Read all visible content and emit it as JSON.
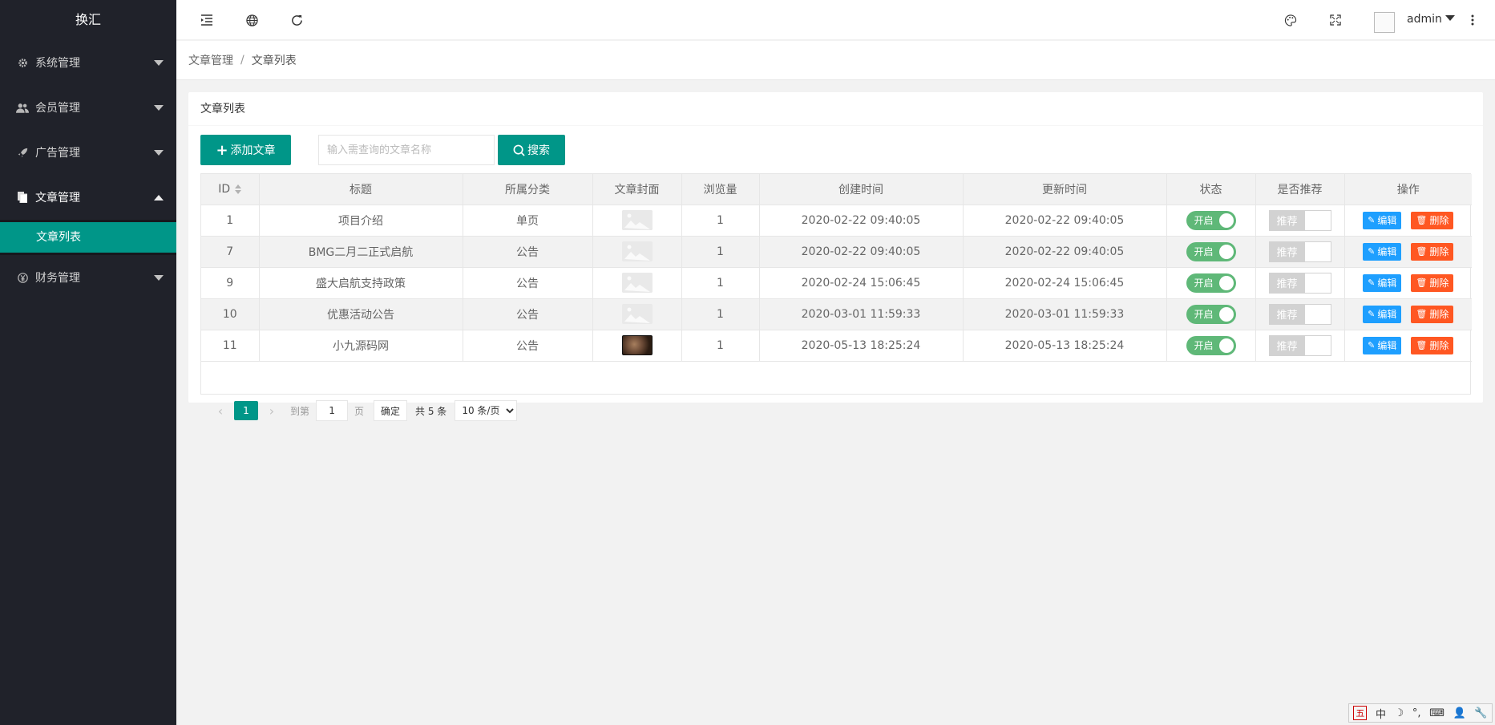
{
  "app": {
    "logo": "换汇"
  },
  "sidebar": {
    "items": [
      {
        "label": "系统管理",
        "icon": "gear-icon"
      },
      {
        "label": "会员管理",
        "icon": "users-icon"
      },
      {
        "label": "广告管理",
        "icon": "rocket-icon"
      },
      {
        "label": "文章管理",
        "icon": "file-icon",
        "open": true,
        "children": [
          {
            "label": "文章列表",
            "active": true
          }
        ]
      },
      {
        "label": "财务管理",
        "icon": "yen-icon"
      }
    ]
  },
  "header": {
    "user": "admin",
    "icons": [
      "menu-fold-icon",
      "globe-icon",
      "refresh-icon",
      "palette-icon",
      "fullscreen-icon",
      "more-icon"
    ]
  },
  "breadcrumb": {
    "items": [
      "文章管理",
      "文章列表"
    ],
    "separator": "/"
  },
  "card": {
    "title": "文章列表",
    "add_label": "添加文章",
    "search_placeholder": "输入需查询的文章名称",
    "search_label": "搜索"
  },
  "table": {
    "columns": [
      "ID",
      "标题",
      "所属分类",
      "文章封面",
      "浏览量",
      "创建时间",
      "更新时间",
      "状态",
      "是否推荐",
      "操作"
    ],
    "rows": [
      {
        "id": "1",
        "title": "项目介绍",
        "category": "单页",
        "cover": "placeholder",
        "views": "1",
        "created": "2020-02-22 09:40:05",
        "updated": "2020-02-22 09:40:05",
        "status": "开启",
        "recommend": "推荐"
      },
      {
        "id": "7",
        "title": "BMG二月二正式启航",
        "category": "公告",
        "cover": "placeholder",
        "views": "1",
        "created": "2020-02-22 09:40:05",
        "updated": "2020-02-22 09:40:05",
        "status": "开启",
        "recommend": "推荐"
      },
      {
        "id": "9",
        "title": "盛大启航支持政策",
        "category": "公告",
        "cover": "placeholder",
        "views": "1",
        "created": "2020-02-24 15:06:45",
        "updated": "2020-02-24 15:06:45",
        "status": "开启",
        "recommend": "推荐"
      },
      {
        "id": "10",
        "title": "优惠活动公告",
        "category": "公告",
        "cover": "placeholder",
        "views": "1",
        "created": "2020-03-01 11:59:33",
        "updated": "2020-03-01 11:59:33",
        "status": "开启",
        "recommend": "推荐"
      },
      {
        "id": "11",
        "title": "小九源码网",
        "category": "公告",
        "cover": "photo",
        "views": "1",
        "created": "2020-05-13 18:25:24",
        "updated": "2020-05-13 18:25:24",
        "status": "开启",
        "recommend": "推荐"
      }
    ],
    "edit_label": "编辑",
    "delete_label": "删除"
  },
  "pager": {
    "current": "1",
    "goto_prefix": "到第",
    "goto_value": "1",
    "goto_suffix": "页",
    "confirm": "确定",
    "total": "共 5 条",
    "page_size": "10 条/页"
  },
  "ime": {
    "items": [
      "五",
      "中",
      "☽",
      "°,",
      "⌨",
      "👤",
      "🔧"
    ]
  },
  "colors": {
    "sidebar_bg": "#20222a",
    "accent": "#009688",
    "switch_on": "#5fb878",
    "edit": "#1e9fff",
    "delete": "#ff5722"
  }
}
